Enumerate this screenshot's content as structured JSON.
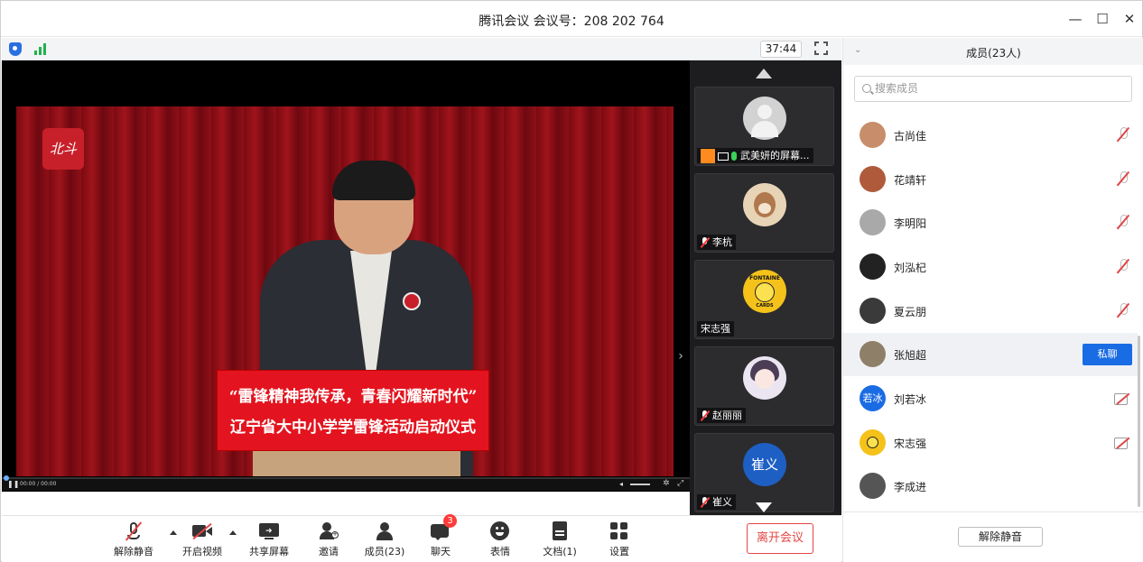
{
  "window": {
    "title": "腾讯会议 会议号：208 202 764",
    "minimize_glyph": "—",
    "maximize_glyph": "☐",
    "close_glyph": "✕"
  },
  "stage": {
    "timer": "37:44",
    "logo_text": "北斗",
    "podium_line1": "“雷锋精神我传承，青春闪耀新时代”",
    "podium_line2": "辽宁省大中小学学雷锋活动启动仪式",
    "player_time": "00:00 / 00:00",
    "expand_glyph": "›"
  },
  "thumbnails": [
    {
      "name": "武美妍的屏幕...",
      "avatar_color": "#c9c9c9",
      "avatar_text": "",
      "muted": false
    },
    {
      "name": "李杭",
      "avatar_color": "#d6b892",
      "avatar_text": "",
      "muted": true
    },
    {
      "name": "宋志强",
      "avatar_color": "#f4c21a",
      "avatar_text": "FONTAINE",
      "muted": false
    },
    {
      "name": "赵丽丽",
      "avatar_color": "#e9e2ee",
      "avatar_text": "",
      "muted": true
    },
    {
      "name": "崔义",
      "avatar_color": "#1e5fc4",
      "avatar_text": "崔义",
      "muted": true
    }
  ],
  "toolbar": {
    "unmute": "解除静音",
    "video": "开启视频",
    "share": "共享屏幕",
    "invite": "邀请",
    "members": "成员(23)",
    "chat": "聊天",
    "chat_badge": "3",
    "emoji": "表情",
    "docs": "文档(1)",
    "settings": "设置",
    "leave": "离开会议"
  },
  "panel": {
    "title": "成员(23人)",
    "collapse_glyph": "⌄",
    "search_placeholder": "搜索成员",
    "private_chat": "私聊",
    "unmute_all": "解除静音",
    "members": [
      {
        "name": "古尚佳",
        "avatar_color": "#c88d6a",
        "avatar_text": "",
        "state": "mic-muted"
      },
      {
        "name": "花靖轩",
        "avatar_color": "#b05a3c",
        "avatar_text": "",
        "state": "mic-muted"
      },
      {
        "name": "李明阳",
        "avatar_color": "#a9a9a9",
        "avatar_text": "",
        "state": "mic-muted"
      },
      {
        "name": "刘泓杞",
        "avatar_color": "#222222",
        "avatar_text": "",
        "state": "mic-muted"
      },
      {
        "name": "夏云朋",
        "avatar_color": "#3a3a3a",
        "avatar_text": "",
        "state": "mic-muted"
      },
      {
        "name": "张旭超",
        "avatar_color": "#8e8068",
        "avatar_text": "",
        "state": "hover"
      },
      {
        "name": "刘若冰",
        "avatar_color": "#1a6ce4",
        "avatar_text": "若冰",
        "state": "cam-off"
      },
      {
        "name": "宋志强",
        "avatar_color": "#f4c21a",
        "avatar_text": "",
        "state": "cam-off"
      },
      {
        "name": "李成进",
        "avatar_color": "#555555",
        "avatar_text": "",
        "state": "none"
      }
    ]
  }
}
